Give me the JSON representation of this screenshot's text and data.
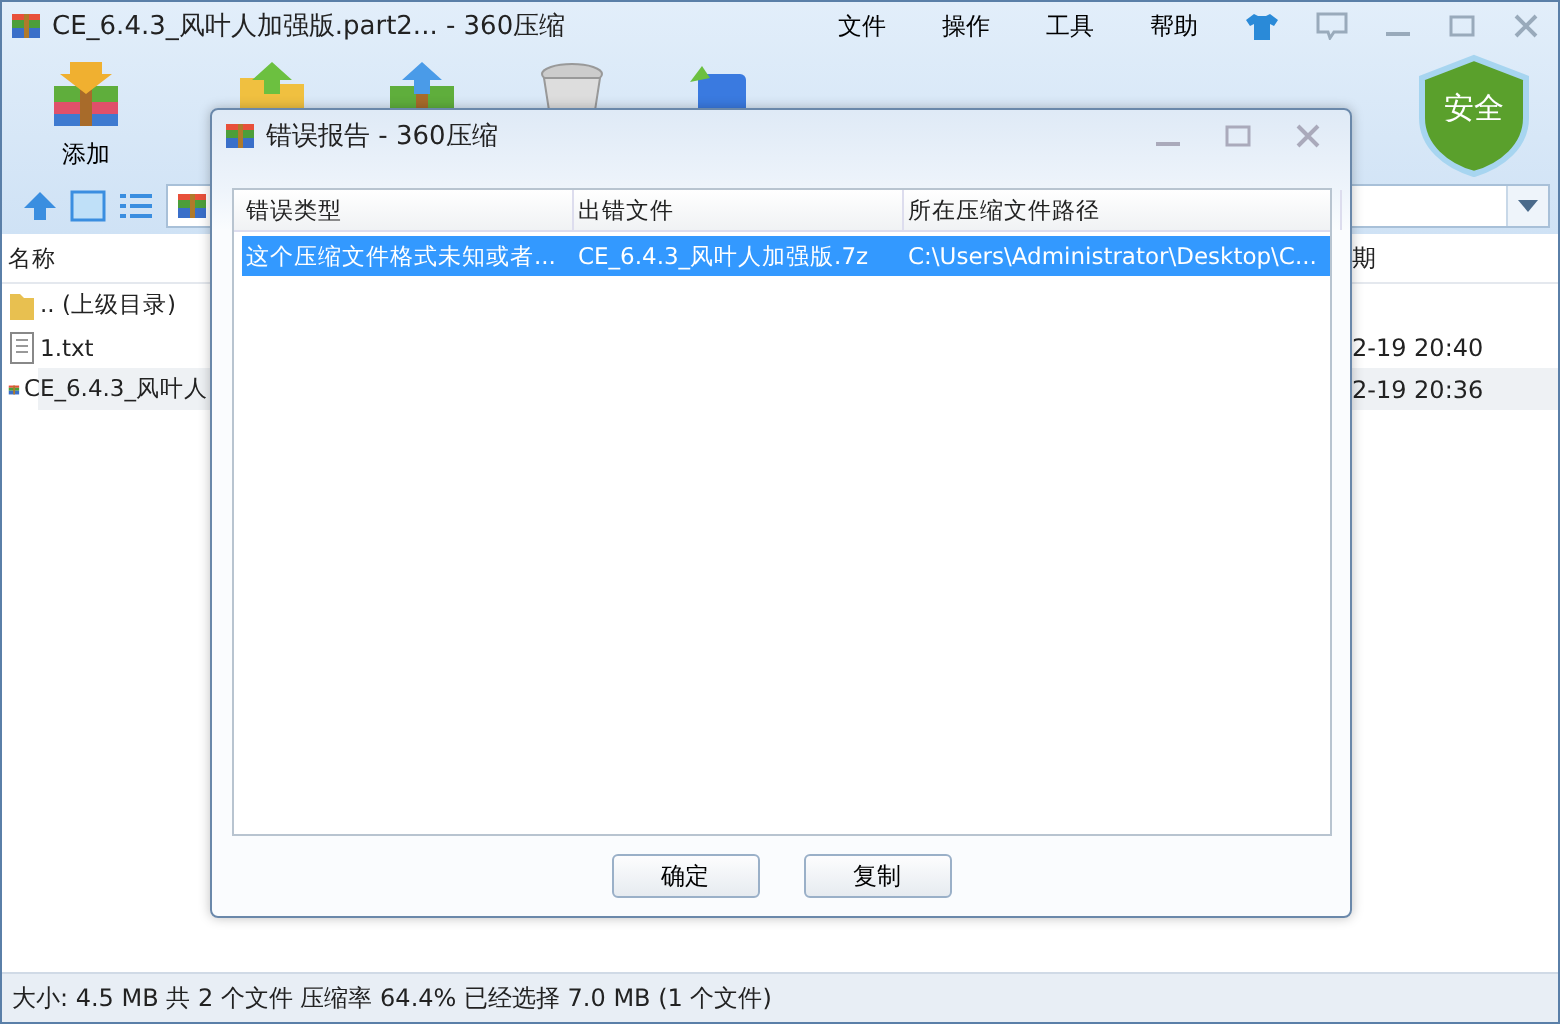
{
  "window": {
    "title": "CE_6.4.3_风叶人加强版.part2... - 360压缩"
  },
  "menu": [
    "文件",
    "操作",
    "工具",
    "帮助"
  ],
  "toolbar": [
    {
      "kind": "add",
      "label": "添加"
    },
    {
      "kind": "extract"
    },
    {
      "kind": "test"
    },
    {
      "kind": "delete"
    },
    {
      "kind": "code"
    }
  ],
  "security_badge": "安全",
  "file_list": {
    "columns": [
      "名称",
      "期"
    ],
    "rows": [
      {
        "kind": "folder",
        "name": ".. (上级目录)",
        "selected": false
      },
      {
        "kind": "text",
        "name": "1.txt",
        "date": "2-19 20:40",
        "selected": false
      },
      {
        "kind": "archive",
        "name": "CE_6.4.3_风叶人",
        "date": "2-19 20:36",
        "selected": true
      }
    ]
  },
  "dialog": {
    "title": "错误报告 - 360压缩",
    "columns": [
      "错误类型",
      "出错文件",
      "所在压缩文件路径"
    ],
    "rows": [
      {
        "cells": [
          "这个压缩文件格式未知或者...",
          "CE_6.4.3_风叶人加强版.7z",
          "C:\\Users\\Administrator\\Desktop\\C..."
        ],
        "selected": true
      }
    ],
    "buttons": [
      "确定",
      "复制"
    ]
  },
  "status_bar": "大小: 4.5 MB 共 2 个文件 压缩率 64.4% 已经选择 7.0 MB (1 个文件)"
}
